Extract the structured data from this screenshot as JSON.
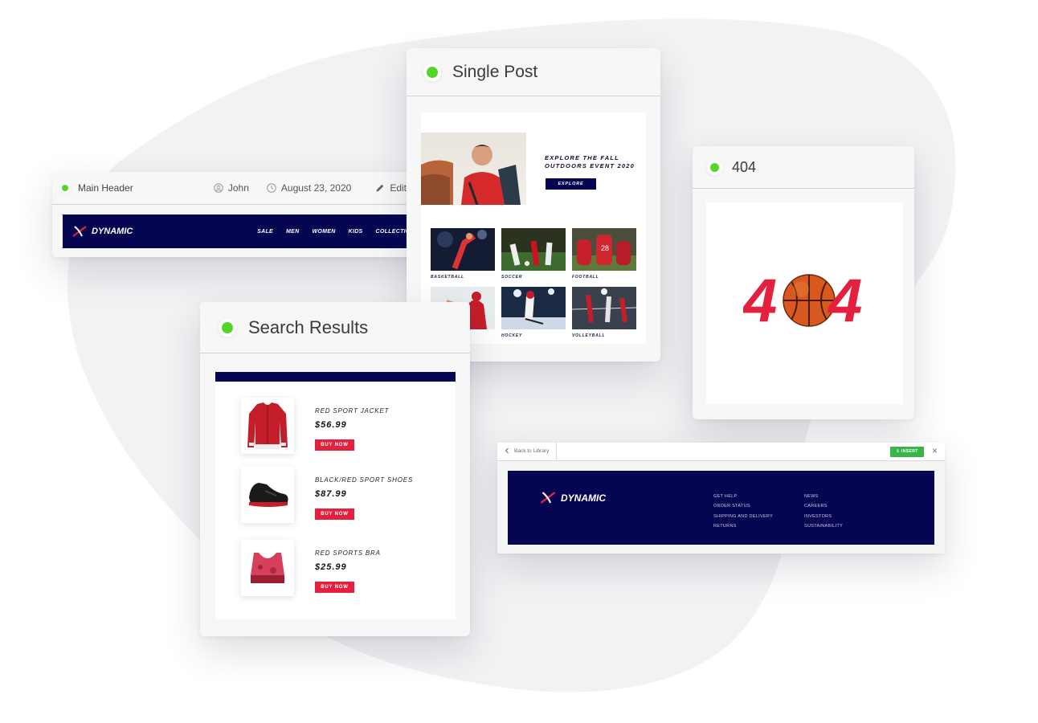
{
  "main_header": {
    "title": "Main Header",
    "author": "John",
    "date": "August 23, 2020",
    "edit_label": "Edit",
    "more": "···",
    "brand": "DYNAMIC",
    "nav": [
      "SALE",
      "MEN",
      "WOMEN",
      "KIDS",
      "COLLECTIONS"
    ]
  },
  "single_post": {
    "title": "Single Post",
    "headline": "EXPLORE THE FALL OUTDOORS EVENT 2020",
    "button": "EXPLORE",
    "tiles": [
      "BASKETBALL",
      "SOCCER",
      "FOOTBALL",
      "",
      "HOCKEY",
      "VOLLEYBALL"
    ]
  },
  "not_found": {
    "title": "404",
    "digit_left": "4",
    "digit_right": "4"
  },
  "search_results": {
    "title": "Search Results",
    "buy_label": "BUY NOW",
    "items": [
      {
        "name": "RED SPORT JACKET",
        "price": "$56.99"
      },
      {
        "name": "BLACK/RED SPORT SHOES",
        "price": "$87.99"
      },
      {
        "name": "RED SPORTS BRA",
        "price": "$25.99"
      }
    ]
  },
  "library": {
    "back_label": "Back to Library",
    "insert_label": "INSERT",
    "close": "×",
    "brand": "DYNAMIC",
    "footer_col1": [
      "GET HELP",
      "ORDER STATUS",
      "SHIPPING AND DELIVERY",
      "RETURNS"
    ],
    "footer_col2": [
      "NEWS",
      "CAREERS",
      "INVESTORS",
      "SUSTAINABILITY"
    ]
  },
  "colors": {
    "navy": "#050552",
    "accent_red": "#e3213f",
    "status_green": "#53d62a",
    "insert_green": "#39b54a"
  }
}
